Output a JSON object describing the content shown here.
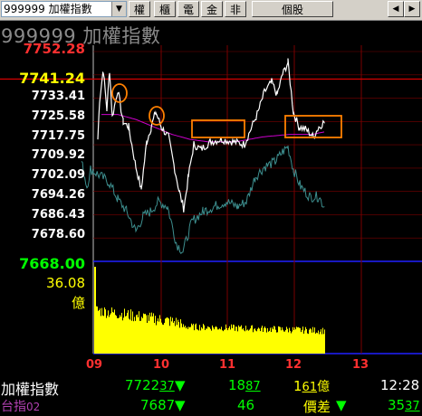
{
  "toolbar": {
    "symbol_select": "999999 加權指數",
    "buttons": [
      "權",
      "櫃",
      "電",
      "金",
      "非"
    ],
    "stock_button": "個股",
    "scroll_left": "◀",
    "scroll_right": "▶"
  },
  "chart_title": "999999 加權指數",
  "chart": {
    "top_label": "7752.28",
    "prev_close": "7741.24",
    "y_labels": [
      "7733.41",
      "7725.58",
      "7717.75",
      "7709.92",
      "7702.09",
      "7694.26",
      "7686.43",
      "7678.60"
    ],
    "bottom_label": "7668.00",
    "volume_top": "36.08",
    "volume_unit": "億",
    "x_labels": [
      "09",
      "10",
      "11",
      "12",
      "13"
    ],
    "colors": {
      "price": "#ffffff",
      "futures": "#3d8f8f",
      "average": "#cc00cc",
      "volume": "#ffff00",
      "ref_line": "#cc0000",
      "grid": "#7a0000",
      "marker": "#ff8000"
    }
  },
  "footer": {
    "row1": {
      "name": "加權指數",
      "price_main": "7722",
      "price_sub": "37",
      "arrow1": "▼",
      "chg_main": "18",
      "chg_sub": "87",
      "vol_main": "1",
      "vol_sub": "61",
      "vol_unit": "億",
      "time": "12:28"
    },
    "row2": {
      "name": "台指",
      "name_sub": "02",
      "price": "7687",
      "arrow1": "▼",
      "chg": "46",
      "spread_label": "價差",
      "arrow2": "▼",
      "spread_main": "35",
      "spread_sub": "37"
    }
  }
}
